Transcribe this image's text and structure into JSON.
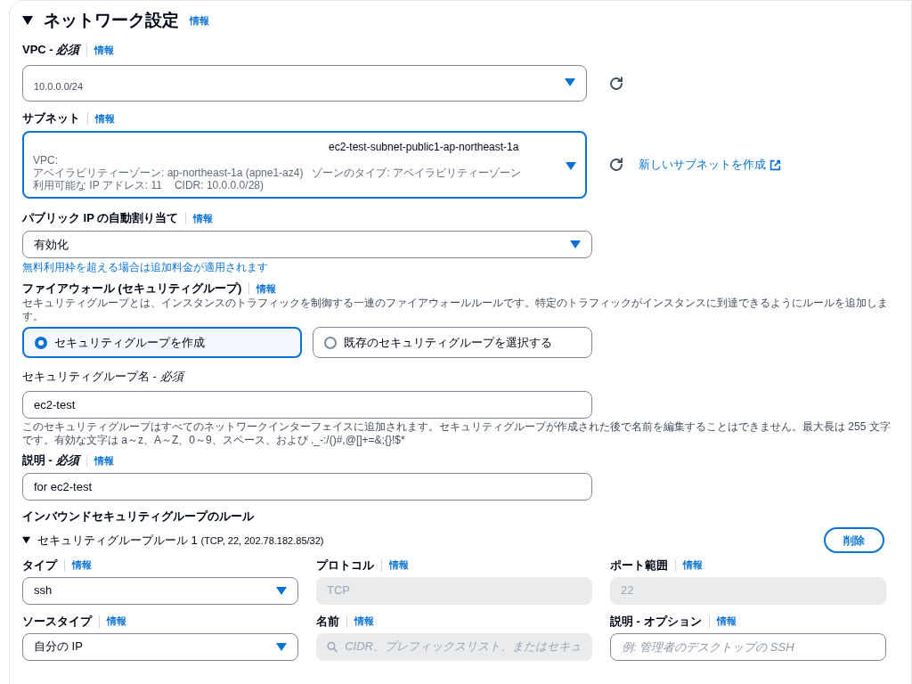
{
  "section": {
    "title": "ネットワーク設定",
    "expanded": true,
    "info": "情報"
  },
  "vpc": {
    "label": "VPC - *必須*",
    "info": "情報",
    "value": "10.0.0.0/24"
  },
  "subnet": {
    "label": "サブネット",
    "info": "情報",
    "name": "ec2-test-subnet-public1-ap-northeast-1a",
    "vpc": "VPC:",
    "az": "アベイラビリティーゾーン: ap-northeast-1a (apne1-az4)",
    "zone_type": "ゾーンのタイプ: アベイラビリティーゾーン",
    "ips": "利用可能な IP アドレス: 11",
    "cidr": "CIDR: 10.0.0.0/28)",
    "create_link": "新しいサブネットを作成"
  },
  "public_ip": {
    "label": "パブリック IP の自動割り当て",
    "info": "情報",
    "value": "有効化",
    "note": "無料利用枠を超える場合は追加料金が適用されます"
  },
  "firewall": {
    "label": "ファイアウォール (セキュリティグループ)",
    "info": "情報",
    "description": "セキュリティグループとは、インスタンスのトラフィックを制御する一連のファイアウォールルールです。特定のトラフィックがインスタンスに到達できるようにルールを追加します。",
    "options": [
      {
        "label": "セキュリティグループを作成",
        "selected": true
      },
      {
        "label": "既存のセキュリティグループを選択する",
        "selected": false
      }
    ]
  },
  "sg_name": {
    "label": "セキュリティグループ名 - *必須*",
    "value": "ec2-test",
    "hint": "このセキュリティグループはすべてのネットワークインターフェイスに追加されます。セキュリティグループが作成された後で名前を編集することはできません。最大長は 255 文字です。有効な文字は a～z、A～Z、0～9、スペース、および ._-:/()#,@[]+=&;{}!$*"
  },
  "description": {
    "label": "説明 - *必須*",
    "info": "情報",
    "value": "for ec2-test"
  },
  "inbound": {
    "title": "インバウンドセキュリティグループのルール",
    "rules": [
      {
        "title": "セキュリティグループルール 1",
        "detail": "(TCP, 22, 202.78.182.85/32)",
        "expanded": true,
        "delete": "削除",
        "fields": [
          {
            "kind": "select",
            "label": "タイプ",
            "info": "情報",
            "value": "ssh"
          },
          {
            "kind": "readonly",
            "label": "プロトコル",
            "info": "情報",
            "value": "TCP"
          },
          {
            "kind": "readonly",
            "label": "ポート範囲",
            "info": "情報",
            "value": "22"
          },
          {
            "kind": "select",
            "label": "ソースタイプ",
            "info": "情報",
            "value": "自分の IP"
          },
          {
            "kind": "search",
            "label": "名前",
            "info": "情報",
            "placeholder": "CIDR、プレフィックスリスト、またはセキュ"
          },
          {
            "kind": "text",
            "label": "説明 - オプション",
            "info": "情報",
            "placeholder": "例: 管理者のデスクトップの SSH"
          }
        ]
      }
    ]
  }
}
